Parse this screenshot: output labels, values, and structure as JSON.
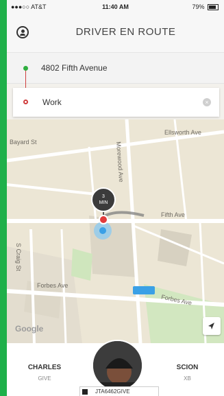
{
  "status_bar": {
    "carrier": "●●●○○ AT&T",
    "time": "11:40 AM",
    "battery": "79%"
  },
  "header": {
    "title": "DRIVER EN ROUTE"
  },
  "pickup": {
    "address": "4802 Fifth Avenue"
  },
  "destination": {
    "label": "Work"
  },
  "map": {
    "streets": [
      "Ellsworth Ave",
      "Bayard St",
      "Morewood Ave",
      "Fifth Ave",
      "S Craig St",
      "Forbes Ave",
      "Forbes Ave"
    ],
    "eta": {
      "value": "3",
      "unit": "MIN"
    },
    "attribution": "Google"
  },
  "driver": {
    "first_name": "CHARLES",
    "last_name": "GIVE"
  },
  "vehicle": {
    "make": "SCION",
    "model": "XB",
    "plate": "JTA6462GIVE"
  },
  "colors": {
    "status_bg": "#1fb04a",
    "pickup_dot": "#2fae3f",
    "dest_dot": "#cf3d3d",
    "pin": "#e23b3b"
  }
}
